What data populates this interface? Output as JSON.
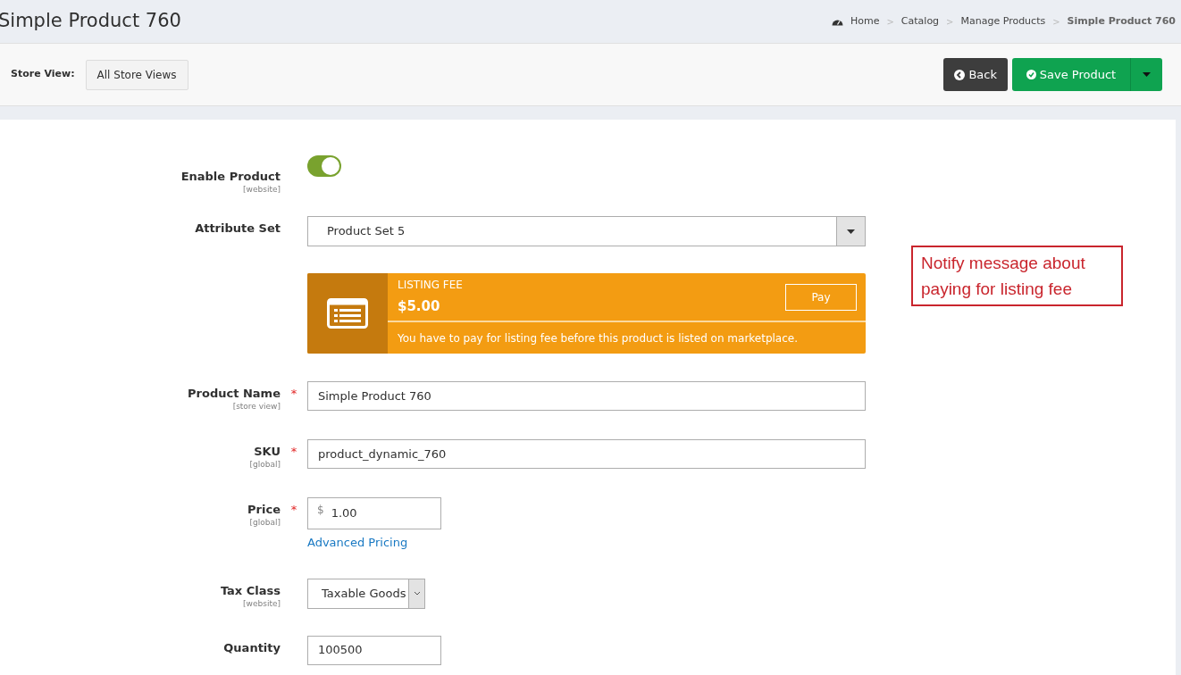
{
  "page_title": "Simple Product 760",
  "breadcrumbs": [
    {
      "label": "Home",
      "current": false
    },
    {
      "label": "Catalog",
      "current": false
    },
    {
      "label": "Manage Products",
      "current": false
    },
    {
      "label": "Simple Product 760",
      "current": true
    }
  ],
  "breadcrumb_separator": ">",
  "store_view": {
    "label": "Store View:",
    "value": "All Store Views"
  },
  "buttons": {
    "back": "Back",
    "save": "Save Product"
  },
  "fields": [
    {
      "kind": "toggle",
      "label": "Enable Product",
      "scope": "[website]",
      "required": false,
      "on": true
    },
    {
      "kind": "select",
      "label": "Attribute Set",
      "value": "Product Set 5",
      "required": false
    },
    {
      "kind": "fee",
      "title": "LISTING FEE",
      "amount": "$5.00",
      "button": "Pay",
      "message": "You have to pay for listing fee before this product is listed on marketplace."
    },
    {
      "kind": "text",
      "label": "Product Name",
      "scope": "[store view]",
      "required": true,
      "value": "Simple Product 760"
    },
    {
      "kind": "text",
      "label": "SKU",
      "scope": "[global]",
      "required": true,
      "value": "product_dynamic_760"
    },
    {
      "kind": "price",
      "label": "Price",
      "scope": "[global]",
      "required": true,
      "currency": "$",
      "value": "1.00",
      "link": "Advanced Pricing"
    },
    {
      "kind": "small-select",
      "label": "Tax Class",
      "scope": "[website]",
      "required": false,
      "value": "Taxable Goods"
    },
    {
      "kind": "short-text",
      "label": "Quantity",
      "required": false,
      "value": "100500"
    }
  ],
  "required_mark": "*",
  "annotation": "Notify message about paying for listing fee"
}
